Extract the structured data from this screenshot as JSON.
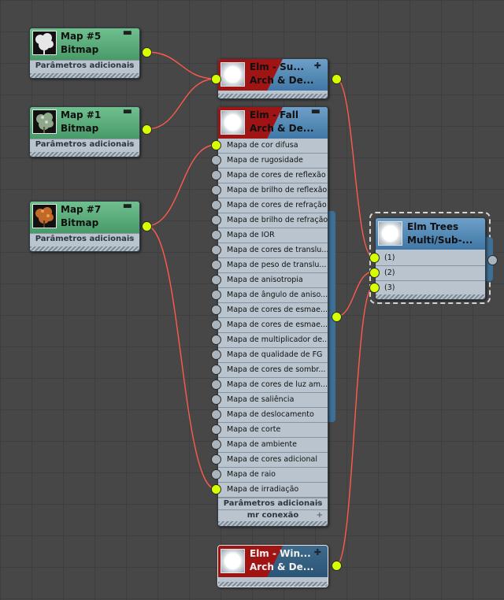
{
  "bitmap_nodes": [
    {
      "title": "Map #5",
      "type": "Bitmap",
      "rollout": "Parâmetros adicionais"
    },
    {
      "title": "Map #1",
      "type": "Bitmap",
      "rollout": "Parâmetros adicionais"
    },
    {
      "title": "Map #7",
      "type": "Bitmap",
      "rollout": "Parâmetros adicionais"
    }
  ],
  "material_nodes": {
    "sub": {
      "title": "Elm - Su...",
      "subtitle": "Arch & De..."
    },
    "fall": {
      "title": "Elm - Fall",
      "subtitle": "Arch & De...",
      "slots": [
        "Mapa de cor difusa",
        "Mapa de rugosidade",
        "Mapa de cores de reflexão",
        "Mapa de brilho de reflexão",
        "Mapa de cores de refração",
        "Mapa de brilho de refração",
        "Mapa de IOR",
        "Mapa de cores de translu...",
        "Mapa de peso de translu...",
        "Mapa de anisotropia",
        "Mapa de ângulo de aniso...",
        "Mapa de cores de esmae...",
        "Mapa de cores de esmae...",
        "Mapa de multiplicador de...",
        "Mapa de qualidade de FG",
        "Mapa de cores de sombr...",
        "Mapa de cores de luz am...",
        "Mapa de saliência",
        "Mapa de deslocamento",
        "Mapa de corte",
        "Mapa de ambiente",
        "Mapa de cores adicional",
        "Mapa de raio",
        "Mapa de irradiação"
      ],
      "rollouts": [
        "Parâmetros adicionais",
        "mr conexão"
      ]
    },
    "win": {
      "title": "Elm - Win...",
      "subtitle": "Arch & De..."
    },
    "multi": {
      "title": "Elm Trees",
      "subtitle": "Multi/Sub-...",
      "slots": [
        "(1)",
        "(2)",
        "(3)"
      ]
    }
  },
  "icons": {
    "collapse": "minus-icon",
    "expand": "plus-icon"
  },
  "colors": {
    "bitmap_header": "#57a877",
    "material_header": "#4a80ad",
    "material_accent": "#a11414",
    "active_port": "#d8ff00",
    "wire": "#e8332e"
  }
}
